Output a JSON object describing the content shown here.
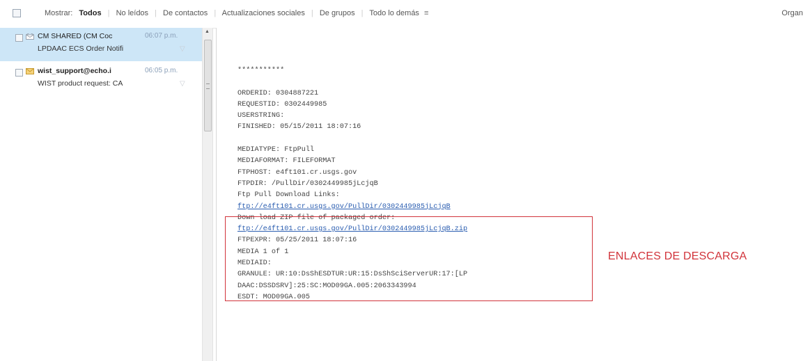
{
  "filter_bar": {
    "show_label": "Mostrar:",
    "items": [
      {
        "label": "Todos",
        "active": true
      },
      {
        "label": "No leídos",
        "active": false
      },
      {
        "label": "De contactos",
        "active": false
      },
      {
        "label": "Actualizaciones sociales",
        "active": false
      },
      {
        "label": "De grupos",
        "active": false
      },
      {
        "label": "Todo lo demás",
        "active": false
      }
    ],
    "more_glyph": "≡",
    "organize_label": "Organ"
  },
  "messages": [
    {
      "from": "CM SHARED (CM Coc",
      "time": "06:07 p.m.",
      "subject": "LPDAAC ECS Order Notifi",
      "selected": true,
      "unread": false,
      "icon": "read-envelope-icon"
    },
    {
      "from": "wist_support@echo.i",
      "time": "06:05 p.m.",
      "subject": "WIST product request: CA",
      "selected": false,
      "unread": true,
      "icon": "unread-envelope-icon"
    }
  ],
  "email_body": {
    "lines": [
      {
        "text": "***********"
      },
      {
        "text": ""
      },
      {
        "text": "ORDERID: 0304887221"
      },
      {
        "text": "REQUESTID: 0302449985"
      },
      {
        "text": "USERSTRING:"
      },
      {
        "text": "FINISHED: 05/15/2011 18:07:16"
      },
      {
        "text": ""
      },
      {
        "text": "MEDIATYPE: FtpPull"
      },
      {
        "text": "MEDIAFORMAT: FILEFORMAT"
      },
      {
        "text": "FTPHOST: e4ft101.cr.usgs.gov"
      },
      {
        "text": "FTPDIR: /PullDir/0302449985jLcjqB"
      },
      {
        "text": "Ftp Pull Download Links:"
      },
      {
        "text": "ftp://e4ft101.cr.usgs.gov/PullDir/0302449985jLcjqB",
        "link": true
      },
      {
        "text": "Down load ZIP file of packaged order:"
      },
      {
        "text": "ftp://e4ft101.cr.usgs.gov/PullDir/0302449985jLcjqB.zip",
        "link": true
      },
      {
        "text": "FTPEXPR: 05/25/2011 18:07:16"
      },
      {
        "text": "MEDIA 1 of 1"
      },
      {
        "text": "MEDIAID:"
      },
      {
        "text": "GRANULE: UR:10:DsShESDTUR:UR:15:DsShSciServerUR:17:[LP"
      },
      {
        "text": "DAAC:DSSDSRV]:25:SC:MOD09GA.005:2063343994"
      },
      {
        "text": "ESDT: MOD09GA.005"
      }
    ]
  },
  "annotation": {
    "text": "ENLACES DE DESCARGA",
    "color": "#d1333a"
  },
  "colors": {
    "selected_row": "#cde6f7",
    "link": "#2a5db0",
    "time": "#8a9fb8"
  }
}
